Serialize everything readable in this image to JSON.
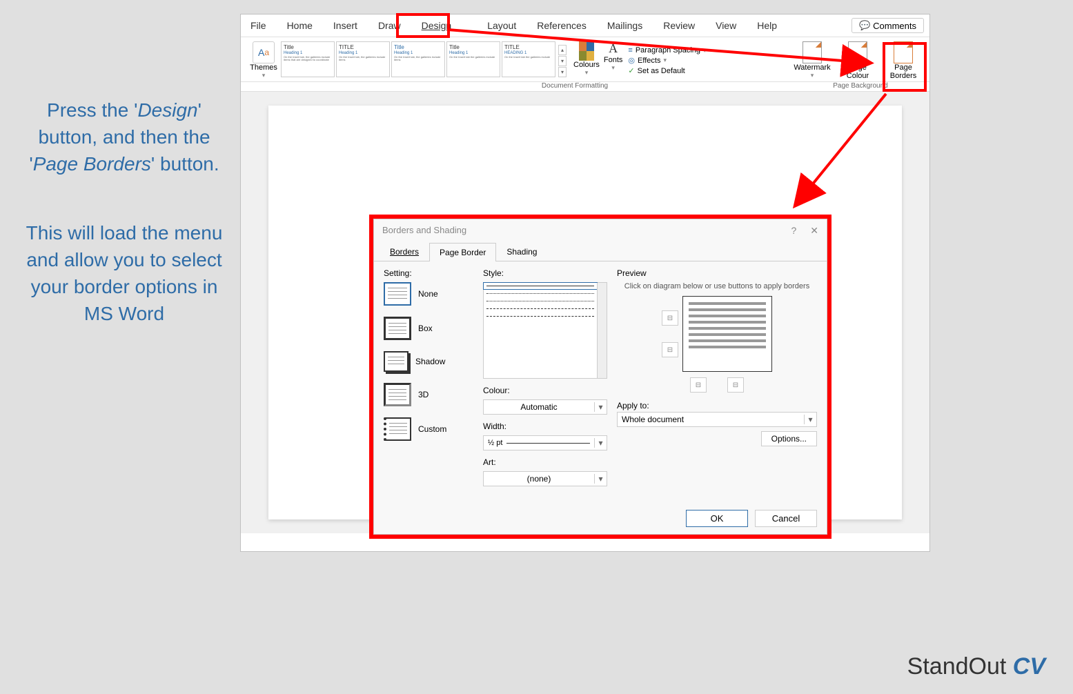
{
  "instruction": {
    "para1_pre": "Press the '",
    "design_em": "Design",
    "para1_mid": "' button, and then the '",
    "borders_em": "Page Borders",
    "para1_post": "' button.",
    "para2": "This will load the menu and allow you to select your border options in MS Word"
  },
  "ribbon": {
    "tabs": [
      "File",
      "Home",
      "Insert",
      "Draw",
      "Design",
      "Layout",
      "References",
      "Mailings",
      "Review",
      "View",
      "Help"
    ],
    "active_tab": "Design",
    "comments": "Comments",
    "themes": "Themes",
    "style_thumbs": [
      {
        "title": "Title",
        "heading": "Heading 1"
      },
      {
        "title": "TITLE",
        "heading": "Heading 1"
      },
      {
        "title": "Title",
        "heading": "Heading 1"
      },
      {
        "title": "Title",
        "heading": "Heading 1"
      },
      {
        "title": "TITLE",
        "heading": "HEADING 1"
      }
    ],
    "colours": "Colours",
    "fonts": "Fonts",
    "paragraph_spacing": "Paragraph Spacing",
    "effects": "Effects",
    "set_default": "Set as Default",
    "watermark": "Watermark",
    "page_colour": "Page Colour",
    "page_borders": "Page Borders",
    "group_docfmt": "Document Formatting",
    "group_pagebg": "Page Background"
  },
  "dialog": {
    "title": "Borders and Shading",
    "tabs": {
      "borders": "Borders",
      "page_border": "Page Border",
      "shading": "Shading"
    },
    "setting_label": "Setting:",
    "settings": {
      "none": "None",
      "box": "Box",
      "shadow": "Shadow",
      "three_d": "3D",
      "custom": "Custom"
    },
    "style_label": "Style:",
    "colour_label": "Colour:",
    "colour_value": "Automatic",
    "width_label": "Width:",
    "width_value": "½ pt",
    "art_label": "Art:",
    "art_value": "(none)",
    "preview_label": "Preview",
    "preview_text": "Click on diagram below or use buttons to apply borders",
    "apply_label": "Apply to:",
    "apply_value": "Whole document",
    "options": "Options...",
    "ok": "OK",
    "cancel": "Cancel"
  },
  "footer": {
    "standout": "StandOut",
    "cv": "CV"
  }
}
